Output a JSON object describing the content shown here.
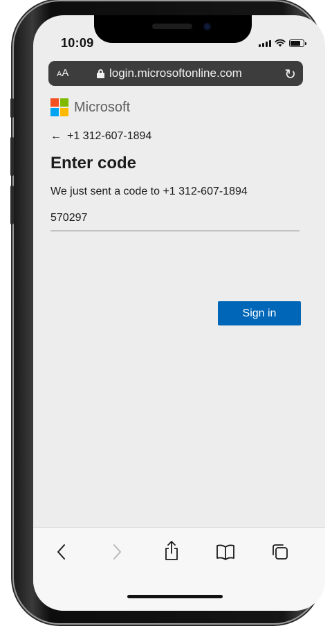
{
  "status_bar": {
    "time": "10:09"
  },
  "browser": {
    "text_size_label_small": "A",
    "text_size_label_large": "A",
    "url": "login.microsoftonline.com"
  },
  "page": {
    "brand": "Microsoft",
    "phone_number": "+1 312-607-1894",
    "title": "Enter code",
    "description": "We just sent a code to +1 312-607-1894",
    "code_value": "570297",
    "sign_in_label": "Sign in"
  },
  "toolbar": {
    "back_icon": "chevron-left",
    "forward_icon": "chevron-right",
    "share_icon": "share",
    "bookmarks_icon": "book",
    "tabs_icon": "tabs"
  }
}
